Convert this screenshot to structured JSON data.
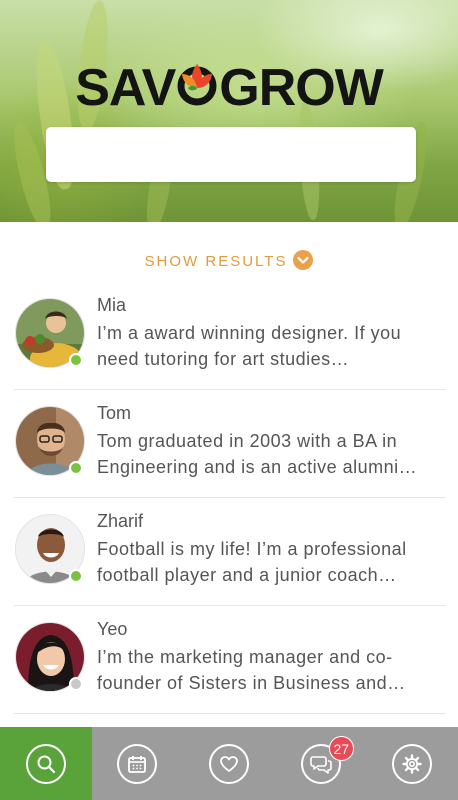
{
  "header": {
    "logo_left": "SAV",
    "logo_right": "GROW",
    "search": {
      "value": "",
      "placeholder": ""
    }
  },
  "show_results": {
    "label": "SHOW RESULTS",
    "icon": "chevron-down-icon"
  },
  "people": [
    {
      "name": "Mia",
      "bio": "I’m a award winning designer. If you need tutoring for art studies…",
      "status": "online"
    },
    {
      "name": "Tom",
      "bio": "Tom graduated in 2003 with a BA in Engineering and is an active alumni…",
      "status": "online"
    },
    {
      "name": "Zharif",
      "bio": "Football is my life! I’m a professional football player and a junior coach…",
      "status": "online"
    },
    {
      "name": "Yeo",
      "bio": "I’m the marketing manager and co-founder of Sisters in Business and…",
      "status": "offline"
    }
  ],
  "tabbar": {
    "tabs": [
      {
        "icon": "search-icon",
        "active": true
      },
      {
        "icon": "calendar-icon",
        "active": false
      },
      {
        "icon": "heart-icon",
        "active": false
      },
      {
        "icon": "chat-icon",
        "active": false,
        "badge": "27"
      },
      {
        "icon": "gear-icon",
        "active": false
      }
    ]
  },
  "colors": {
    "accent_green": "#5aa33b",
    "accent_orange": "#e39a3f",
    "online": "#7cc242",
    "offline": "#c8c8c8",
    "badge": "#e84b55",
    "tabbar_bg": "#9c9c9c"
  }
}
